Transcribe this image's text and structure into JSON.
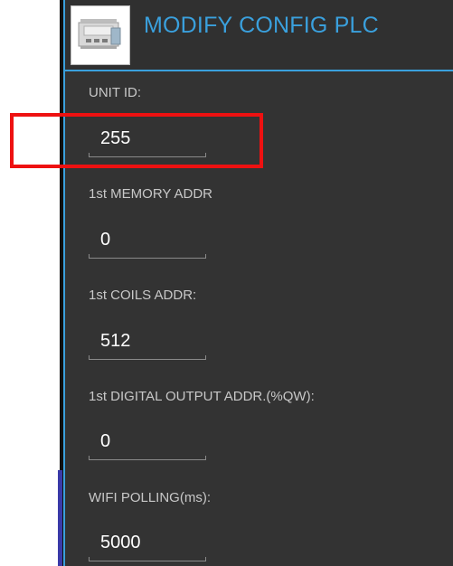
{
  "header": {
    "title": "MODIFY CONFIG PLC",
    "logo_icon": "plc-device-icon"
  },
  "fields": {
    "unit_id": {
      "label": "UNIT ID:",
      "value": "255"
    },
    "memory_addr": {
      "label": "1st MEMORY ADDR",
      "value": "0"
    },
    "coils_addr": {
      "label": "1st COILS ADDR:",
      "value": "512"
    },
    "digital_output_addr": {
      "label": "1st DIGITAL OUTPUT ADDR.(%QW):",
      "value": "0"
    },
    "wifi_polling": {
      "label": "WIFI POLLING(ms):",
      "value": "5000"
    }
  },
  "colors": {
    "accent": "#3aa0dd",
    "panel": "#333333",
    "highlight": "#ee1111"
  }
}
